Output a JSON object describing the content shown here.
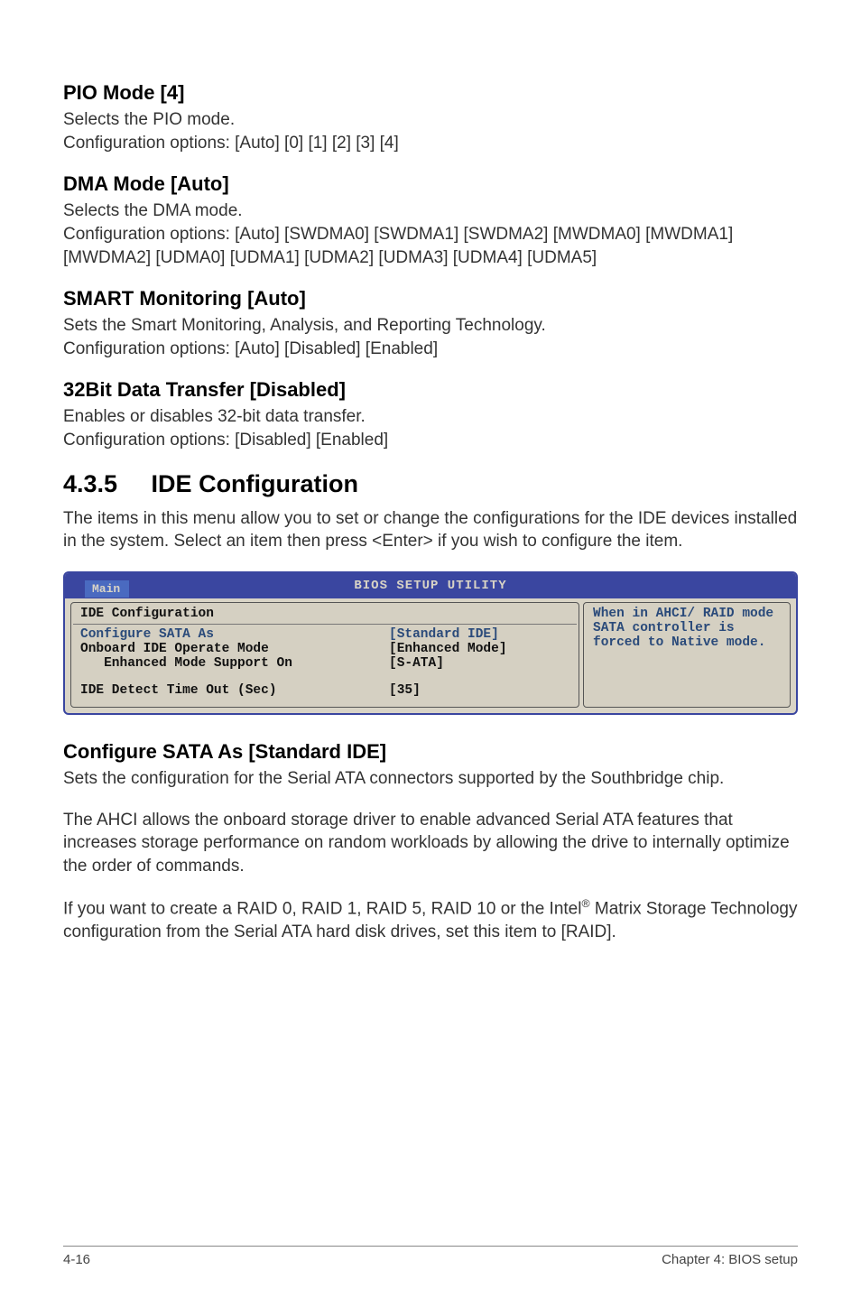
{
  "sections": {
    "pio": {
      "heading": "PIO Mode [4]",
      "line1": "Selects the PIO mode.",
      "line2": "Configuration options: [Auto] [0] [1] [2] [3] [4]"
    },
    "dma": {
      "heading": "DMA Mode [Auto]",
      "line1": "Selects the DMA mode.",
      "line2": "Configuration options: [Auto] [SWDMA0] [SWDMA1] [SWDMA2] [MWDMA0] [MWDMA1] [MWDMA2] [UDMA0] [UDMA1] [UDMA2] [UDMA3] [UDMA4] [UDMA5]"
    },
    "smart": {
      "heading": "SMART Monitoring [Auto]",
      "line1": "Sets the Smart Monitoring, Analysis, and Reporting Technology.",
      "line2": "Configuration options: [Auto] [Disabled] [Enabled]"
    },
    "data32": {
      "heading": "32Bit Data Transfer [Disabled]",
      "line1": "Enables or disables 32-bit data transfer.",
      "line2": "Configuration options: [Disabled] [Enabled]"
    },
    "ideconf": {
      "heading": "4.3.5     IDE Configuration",
      "body": "The items in this menu allow you to set or change the configurations for the IDE devices installed in the system. Select an item then press <Enter> if you wish to configure the item."
    },
    "confsata": {
      "heading": "Configure SATA As [Standard IDE]",
      "p1": "Sets the configuration for the Serial ATA connectors supported by the Southbridge chip.",
      "p2": "The AHCI allows the onboard storage driver to enable advanced Serial ATA features that increases storage performance on random workloads by allowing the drive to internally optimize the order of commands.",
      "p3a": "If you want to create a RAID 0, RAID 1, RAID 5, RAID 10 or the Intel",
      "p3sup": "®",
      "p3b": " Matrix Storage Technology configuration from the Serial ATA hard disk drives, set this item to [RAID]."
    }
  },
  "bios": {
    "title": "BIOS SETUP UTILITY",
    "tab": "Main",
    "left_title": "IDE Configuration",
    "rows": [
      {
        "label": "Configure SATA As",
        "value": "[Standard IDE]",
        "style": "blue"
      },
      {
        "label": "Onboard IDE Operate Mode",
        "value": "[Enhanced Mode]",
        "style": "black"
      },
      {
        "label": "   Enhanced Mode Support On",
        "value": "[S-ATA]",
        "style": "black"
      }
    ],
    "row_detect": {
      "label": "IDE Detect Time Out (Sec)",
      "value": "[35]"
    },
    "help": "When in AHCI/ RAID mode SATA controller is forced to Native mode."
  },
  "footer": {
    "left": "4-16",
    "right": "Chapter 4: BIOS setup"
  }
}
